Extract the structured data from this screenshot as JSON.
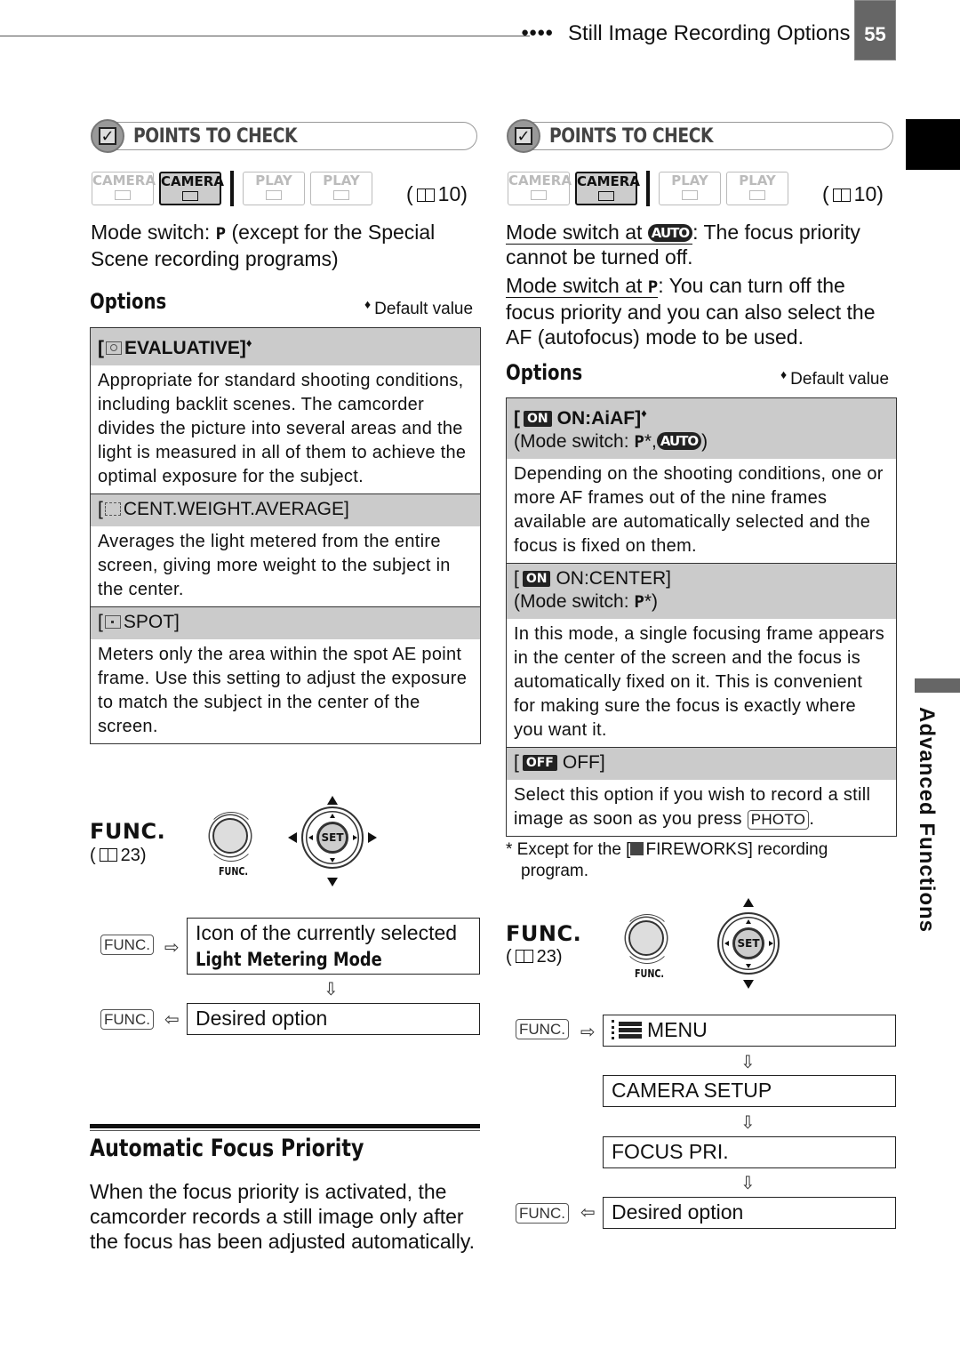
{
  "header": {
    "dots": "●●●●",
    "section_title": "Still Image Recording Options",
    "page_number": "55"
  },
  "side_tab": {
    "label": "Advanced Functions"
  },
  "left": {
    "points_to_check": "POINTS TO CHECK",
    "modes": [
      {
        "top": "CAMERA",
        "icon": "tape-icon",
        "active": false
      },
      {
        "top": "CAMERA",
        "icon": "card-icon",
        "active": true
      },
      {
        "top": "PLAY",
        "icon": "tape-icon",
        "active": false
      },
      {
        "top": "PLAY",
        "icon": "card-icon",
        "active": false
      }
    ],
    "ref": "10",
    "mode_switch_pre": "Mode switch: ",
    "mode_switch_p": "P",
    "mode_switch_post": " (except for the Special Scene recording programs)",
    "options_heading": "Options",
    "default_value": "Default value",
    "options": [
      {
        "title": "EVALUATIVE]",
        "icon": "evaluative-icon",
        "default": true,
        "body": "Appropriate for standard shooting conditions, including backlit scenes. The camcorder divides the picture into several areas and the light is measured in all of them to achieve the optimal exposure for the subject."
      },
      {
        "title": "CENT.WEIGHT.AVERAGE]",
        "icon": "center-weighted-icon",
        "default": false,
        "body": "Averages the light metered from the entire screen, giving more weight to the subject in the center."
      },
      {
        "title": "SPOT]",
        "icon": "spot-icon",
        "default": false,
        "body": "Meters only the area within the spot AE point frame. Use this setting to adjust the exposure to match the subject in the center of the screen."
      }
    ],
    "func": {
      "title": "FUNC.",
      "ref": "23",
      "button_label": "FUNC.",
      "set_label": "SET"
    },
    "flow": {
      "key": "FUNC.",
      "step1_line1": "Icon of the currently selected",
      "step1_line2": "Light Metering Mode",
      "step2": "Desired option"
    },
    "section": {
      "title": "Automatic Focus Priority",
      "body": "When the focus priority is activated, the camcorder records a still image only after the focus has been adjusted automatically."
    }
  },
  "right": {
    "points_to_check": "POINTS TO CHECK",
    "ref": "10",
    "auto_label": "AUTO",
    "line1_u": "Mode switch at ",
    "line1_rest": ": The focus priority cannot be turned off.",
    "line2_u": "Mode switch at ",
    "line2_p": "P",
    "line2_rest": ": You can turn off the focus priority and you can also select the AF (autofocus) mode to be used.",
    "options_heading": "Options",
    "default_value": "Default value",
    "options": [
      {
        "badge": "ON",
        "title": "ON:AiAF]",
        "default": true,
        "mode_pre": "(Mode switch: ",
        "mode_p": "P",
        "mode_post": "*,",
        "mode_auto": "AUTO",
        "mode_end": ")",
        "body": "Depending on the shooting conditions, one or more AF frames out of the nine frames available are automatically selected and the focus is fixed on them."
      },
      {
        "badge": "ON",
        "title": "ON:CENTER]",
        "default": false,
        "mode_pre": "(Mode switch: ",
        "mode_p": "P",
        "mode_post": "*)",
        "body": "In this mode, a single focusing frame appears in the center of the screen and the focus is automatically fixed on it. This is convenient for making sure the focus is exactly where you want it."
      },
      {
        "badge": "OFF",
        "title": "OFF]",
        "default": false,
        "body_pre": "Select this option if you wish to record a still image as soon as you press ",
        "body_key": "PHOTO",
        "body_post": "."
      }
    ],
    "footnote_pre": "*  Except for the [",
    "footnote_item": "FIREWORKS] recording",
    "footnote_post": "program.",
    "func": {
      "title": "FUNC.",
      "ref": "23",
      "button_label": "FUNC.",
      "set_label": "SET"
    },
    "flow": {
      "key": "FUNC.",
      "steps": [
        "MENU",
        "CAMERA SETUP",
        "FOCUS PRI.",
        "Desired option"
      ]
    }
  }
}
